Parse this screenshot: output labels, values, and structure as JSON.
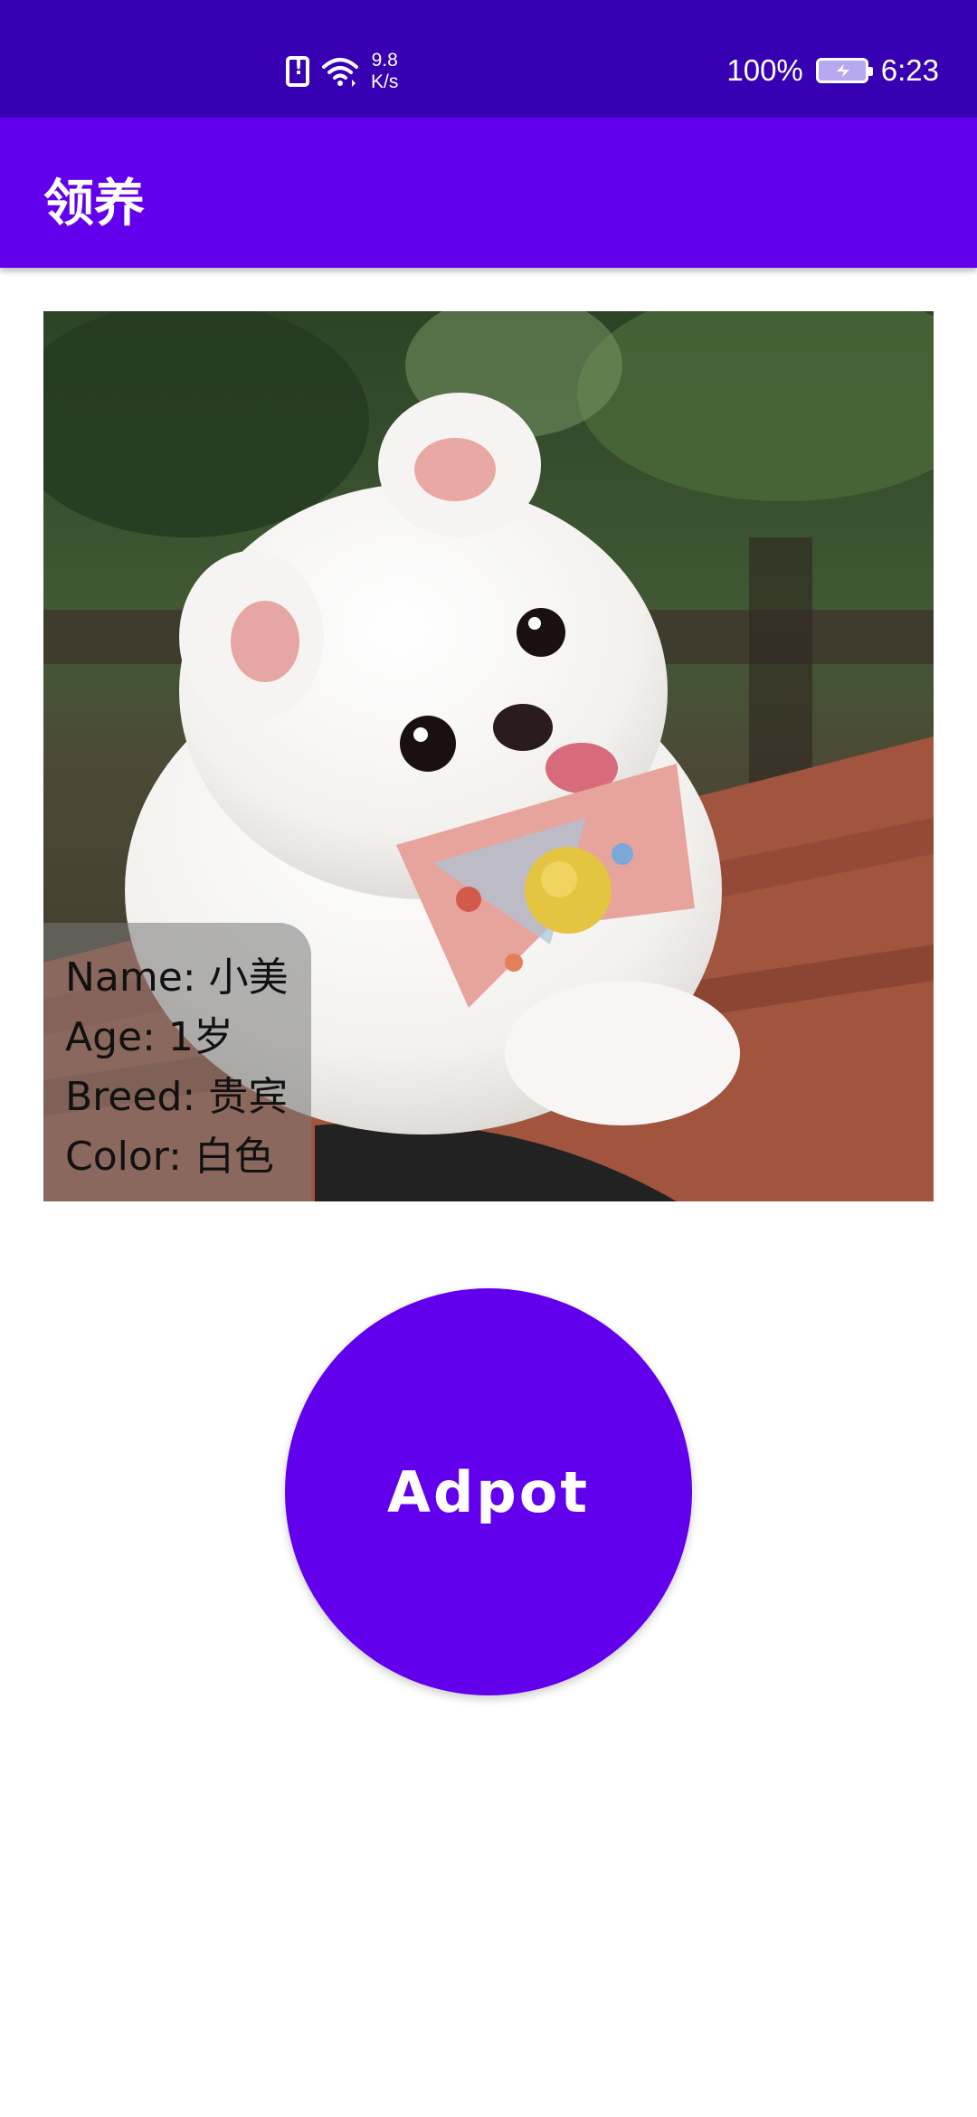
{
  "status_bar": {
    "icons": [
      "sim-alert-icon",
      "wifi-icon"
    ],
    "net_speed_value": "9.8",
    "net_speed_unit": "K/s",
    "battery_percent": "100%",
    "battery_icon": "battery-charging-icon",
    "time": "6:23"
  },
  "app_bar": {
    "title": "领养"
  },
  "pet": {
    "photo_icon": "white-pomeranian-puppy-photo",
    "name_line": "Name: 小美",
    "age_line": "Age: 1岁",
    "breed_line": "Breed: 贵宾",
    "color_line": "Color: 白色"
  },
  "adopt_button": {
    "label": "Adpot"
  },
  "colors": {
    "status_bar": "#3700b3",
    "app_bar": "#6200ee",
    "button": "#6200ee",
    "text_on_primary": "#ffffff",
    "overlay_text": "#111111"
  }
}
